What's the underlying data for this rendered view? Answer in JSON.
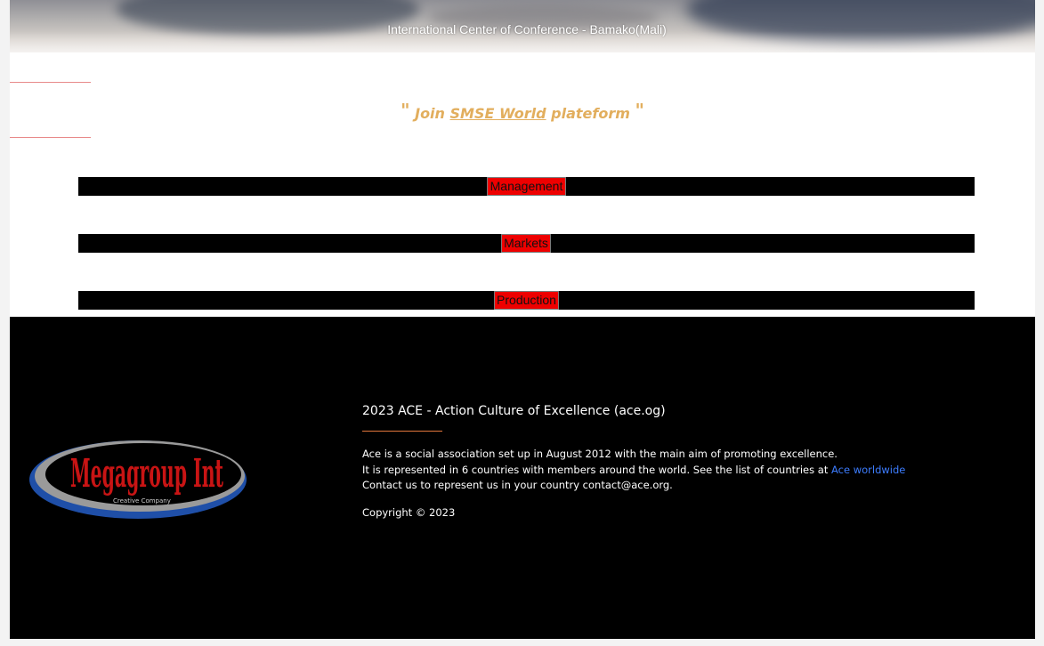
{
  "hero": {
    "caption": "International Center of Conference - Bamako(Mali)"
  },
  "join": {
    "open_quote": "\"",
    "prefix": "Join ",
    "link": "SMSE World",
    "suffix": " plateform",
    "close_quote": "\""
  },
  "sections": [
    {
      "label": "Management"
    },
    {
      "label": "Markets"
    },
    {
      "label": "Production"
    }
  ],
  "footer": {
    "title": "2023 ACE - Action Culture of Excellence (ace.og)",
    "line1": "Ace is a social association set up in August 2012 with the main aim of promoting excellence.",
    "line2_prefix": "It is represented in 6 countries with members around the world. See the list of countries at ",
    "line2_link": "Ace worldwide",
    "line3": "Contact us to represent us in your country contact@ace.org.",
    "copyright": "Copyright © 2023",
    "logo_text": "Megagroup Int",
    "logo_tagline": "Creative Company"
  },
  "colors": {
    "accent_gold": "#e2ae5d",
    "section_button_red": "#ee0000",
    "link_blue": "#3d7dff",
    "footer_line": "#e2763c"
  }
}
